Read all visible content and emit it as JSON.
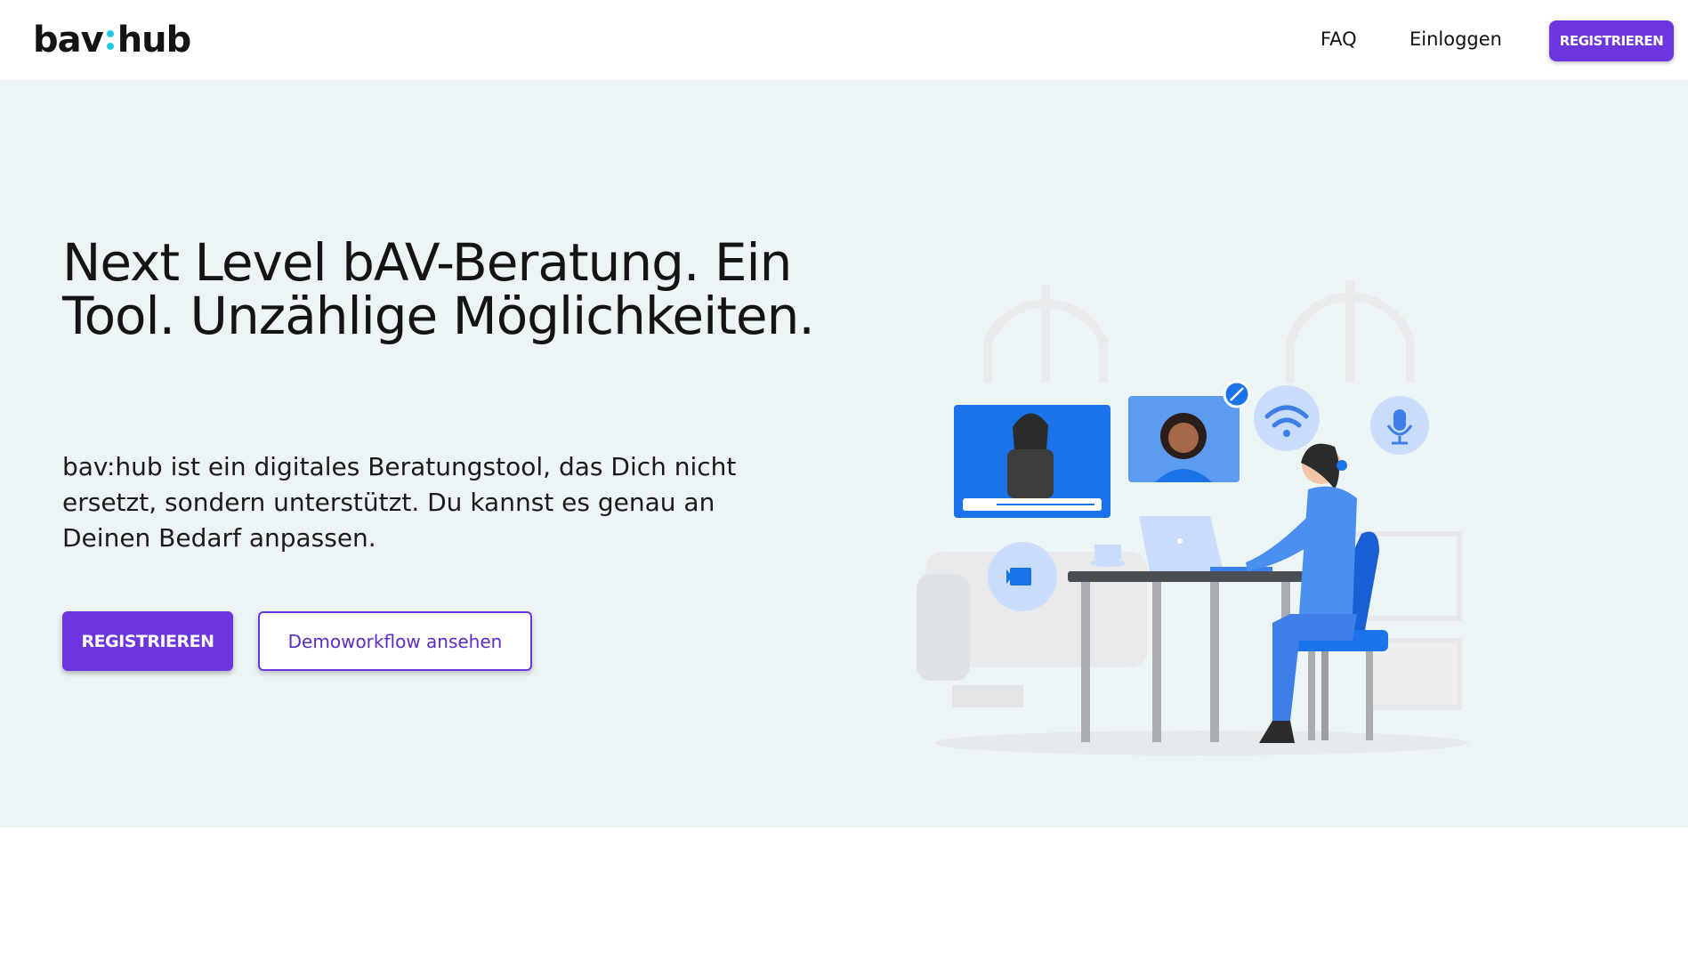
{
  "header": {
    "logo_left": "bav",
    "logo_right": "hub",
    "nav": {
      "faq": "FAQ",
      "login": "Einloggen",
      "register": "REGISTRIEREN"
    }
  },
  "hero": {
    "title": "Next Level bAV-Beratung. Ein Tool. Unzählige Möglichkeiten.",
    "description": "bav:hub ist ein digitales Beratungstool, das Dich nicht ersetzt, sondern unterstützt. Du kannst es genau an Deinen Bedarf anpassen.",
    "primary_button": "REGISTRIEREN",
    "secondary_button": "Demoworkflow ansehen"
  },
  "colors": {
    "accent": "#6c35de",
    "logo_dot": "#22c7e0",
    "hero_background": "#ecf4f6",
    "illustration_blue": "#1a73e8"
  },
  "icons": [
    "video-call-icon",
    "microphone-icon",
    "wifi-icon",
    "camera-icon",
    "mute-icon"
  ]
}
